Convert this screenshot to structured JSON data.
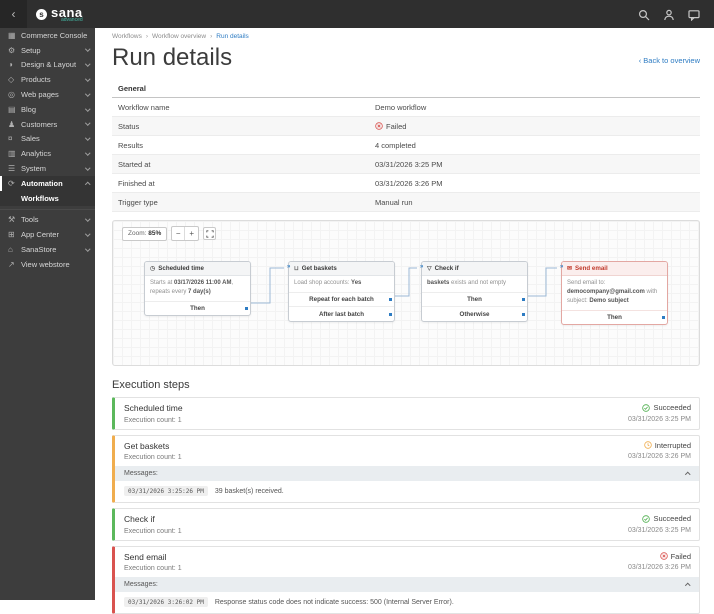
{
  "colors": {
    "accent": "#2e7cc3",
    "success": "#4cae4c",
    "warning": "#f0ad4e",
    "danger": "#d9534f"
  },
  "topbar": {
    "back": "‹",
    "logo": "sana",
    "logo_sub": "advanced",
    "logo_mark": "s"
  },
  "sidebar": {
    "items": [
      {
        "label": "Commerce Console",
        "glyph": "▦"
      },
      {
        "label": "Setup",
        "glyph": "⚙"
      },
      {
        "label": "Design & Layout",
        "glyph": "◑"
      },
      {
        "label": "Products",
        "glyph": "◇"
      },
      {
        "label": "Web pages",
        "glyph": "◎"
      },
      {
        "label": "Blog",
        "glyph": "▤"
      },
      {
        "label": "Customers",
        "glyph": "♟"
      },
      {
        "label": "Sales",
        "glyph": "¤"
      },
      {
        "label": "Analytics",
        "glyph": "▥"
      },
      {
        "label": "System",
        "glyph": "☰"
      },
      {
        "label": "Automation",
        "glyph": "⟳"
      },
      {
        "label": "Workflows"
      },
      {
        "label": "Tools",
        "glyph": "⚒"
      },
      {
        "label": "App Center",
        "glyph": "⊞"
      },
      {
        "label": "SanaStore",
        "glyph": "⌂"
      },
      {
        "label": "View webstore",
        "glyph": "↗"
      }
    ]
  },
  "breadcrumb": {
    "items": [
      "Workflows",
      "Workflow overview",
      "Run details"
    ],
    "separator": "›"
  },
  "page": {
    "title": "Run details",
    "back_glyph": "‹",
    "back_link": "Back to overview"
  },
  "general": {
    "heading": "General",
    "rows": [
      {
        "label": "Workflow name",
        "value": "Demo workflow"
      },
      {
        "label": "Status",
        "value": "Failed"
      },
      {
        "label": "Results",
        "value": "4 completed"
      },
      {
        "label": "Started at",
        "value": "03/31/2026 3:25 PM"
      },
      {
        "label": "Finished at",
        "value": "03/31/2026 3:26 PM"
      },
      {
        "label": "Trigger type",
        "value": "Manual run"
      }
    ]
  },
  "diagram": {
    "zoom_label": "Zoom:",
    "zoom_value": "85%",
    "minus": "−",
    "plus": "+",
    "input_marker": "»",
    "nodes": [
      {
        "title": "Scheduled time",
        "glyph": "◷",
        "text1": "Starts at ",
        "strong1": "03/17/2026 11:00 AM",
        "text2": ", repeats every ",
        "strong2": "7 day(s)",
        "outputs": [
          "Then"
        ]
      },
      {
        "title": "Get baskets",
        "glyph": "⊔",
        "text1": "Load shop accounts: ",
        "strong1": "Yes",
        "text2": "",
        "strong2": "",
        "outputs": [
          "Repeat for each batch",
          "After last batch"
        ]
      },
      {
        "title": "Check if",
        "glyph": "▽",
        "text1": "",
        "strong1": "baskets",
        "text2": " exists and not empty",
        "strong2": "",
        "outputs": [
          "Then",
          "Otherwise"
        ]
      },
      {
        "title": "Send email",
        "glyph": "✉",
        "text1": "Send email to: ",
        "strong1": "democompany@gmail.com",
        "text2": " with subject: ",
        "strong2": "Demo subject",
        "outputs": [
          "Then"
        ]
      }
    ]
  },
  "execution": {
    "heading": "Execution steps",
    "steps": [
      {
        "title": "Scheduled time",
        "count": "Execution count: 1",
        "status_label": "Succeeded",
        "time": "03/31/2026 3:25 PM"
      },
      {
        "title": "Get baskets",
        "count": "Execution count: 1",
        "status_label": "Interrupted",
        "time": "03/31/2026 3:26 PM",
        "messages_label": "Messages:",
        "message_time": "03/31/2026 3:25:26 PM",
        "message_text": "39 basket(s) received."
      },
      {
        "title": "Check if",
        "count": "Execution count: 1",
        "status_label": "Succeeded",
        "time": "03/31/2026 3:25 PM"
      },
      {
        "title": "Send email",
        "count": "Execution count: 1",
        "status_label": "Failed",
        "time": "03/31/2026 3:26 PM",
        "messages_label": "Messages:",
        "message_time": "03/31/2026 3:26:02 PM",
        "message_text": "Response status code does not indicate success: 500 (Internal Server Error)."
      }
    ]
  }
}
